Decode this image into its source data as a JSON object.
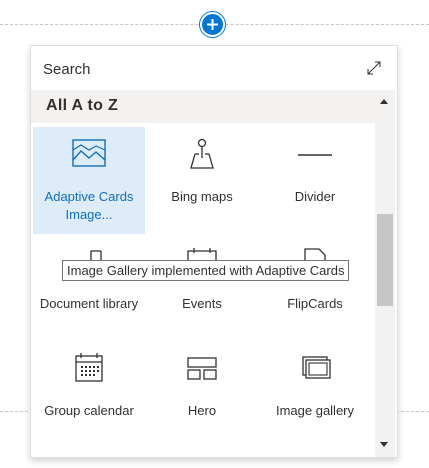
{
  "canvas": {
    "add_webpart_tooltip": ""
  },
  "toolbox": {
    "search_placeholder": "Search",
    "search_value": "",
    "expand_icon": "expand-diagonal-icon",
    "section_title": "All A to Z",
    "items": [
      {
        "label": "Adaptive Cards Image...",
        "icon": "image-gallery-cards-icon",
        "selected": true
      },
      {
        "label": "Bing maps",
        "icon": "map-pin-icon",
        "selected": false
      },
      {
        "label": "Divider",
        "icon": "divider-line-icon",
        "selected": false
      },
      {
        "label": "Document library",
        "icon": "folder-icon",
        "selected": false
      },
      {
        "label": "Events",
        "icon": "calendar-icon",
        "selected": false
      },
      {
        "label": "FlipCards",
        "icon": "page-icon",
        "selected": false
      },
      {
        "label": "Group calendar",
        "icon": "calendar-grid-icon",
        "selected": false
      },
      {
        "label": "Hero",
        "icon": "hero-layout-icon",
        "selected": false
      },
      {
        "label": "Image gallery",
        "icon": "image-gallery-icon",
        "selected": false
      }
    ],
    "tooltip": "Image Gallery implemented with Adaptive Cards"
  },
  "colors": {
    "accent": "#0078d4",
    "selected_bg": "#deecf9",
    "selected_text": "#106ebe",
    "header_bg": "#f3f2f1",
    "text": "#323130"
  }
}
